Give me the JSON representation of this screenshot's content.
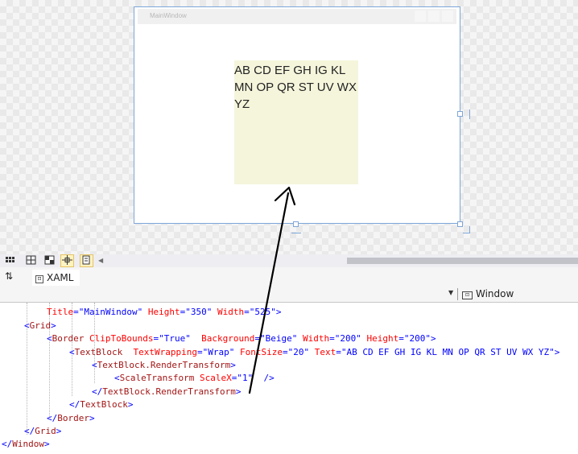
{
  "designer": {
    "window_title": "MainWindow",
    "border_text": "AB CD EF GH IG KL MN OP QR ST UV WX YZ",
    "border_background": "#F5F5DC"
  },
  "toolbar": {
    "icons": [
      "grid-view-icon",
      "split-horizontal-icon",
      "checker-icon",
      "snap-to-gridlines-icon",
      "snap-to-lines-icon"
    ]
  },
  "tabs": {
    "swap_label": "⇅",
    "xaml_tab_label": "XAML"
  },
  "navigation": {
    "element_label": "Window"
  },
  "code": {
    "line1": {
      "attr1": "Title",
      "val1": "\"MainWindow\"",
      "attr2": "Height",
      "val2": "\"350\"",
      "attr3": "Width",
      "val3": "\"525\"",
      "close": ">"
    },
    "line2": {
      "element": "Grid"
    },
    "line3": {
      "element": "Border",
      "attr1": "ClipToBounds",
      "val1": "\"True\"",
      "attr2": "Background",
      "val2": "\"Beige\"",
      "attr3": "Width",
      "val3": "\"200\"",
      "attr4": "Height",
      "val4": "\"200\""
    },
    "line4": {
      "element": "TextBlock",
      "attr1": "TextWrapping",
      "val1": "\"Wrap\"",
      "attr2": "FontSize",
      "val2": "\"20\"",
      "attr3": "Text",
      "val3": "\"AB CD EF GH IG KL MN OP QR ST UV WX YZ\""
    },
    "line5": {
      "element": "TextBlock.RenderTransform"
    },
    "line6": {
      "element": "ScaleTransform",
      "attr1": "ScaleX",
      "val1": "\"1\""
    },
    "line7": {
      "element": "TextBlock.RenderTransform"
    },
    "line8": {
      "element": "TextBlock"
    },
    "line9": {
      "element": "Border"
    },
    "line10": {
      "element": "Grid"
    },
    "line11": {
      "element": "Window"
    }
  },
  "colors": {
    "xaml_bracket": "#0000FF",
    "xaml_element": "#A31515",
    "xaml_attribute": "#FF0000",
    "xaml_value": "#0000FF",
    "selection_outline": "#7EA6D8"
  }
}
